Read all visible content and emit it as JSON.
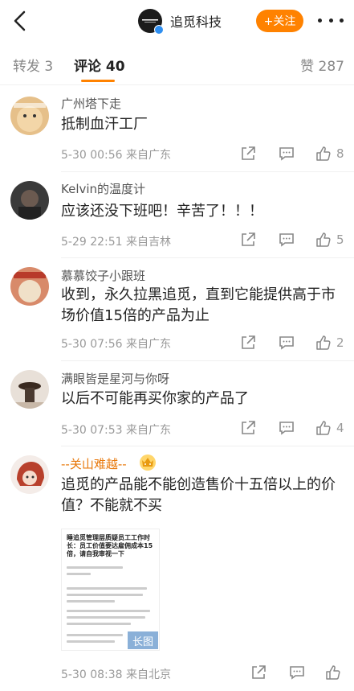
{
  "header": {
    "account_name": "追觅科技",
    "follow_label": "+关注",
    "accent": "#ff8200"
  },
  "tabs": {
    "repost": "转发 3",
    "comments": "评论 40",
    "likes": "赞 287"
  },
  "comments": [
    {
      "user": "广州塔下走",
      "text": "抵制血汗工厂",
      "meta": "5-30 00:56  来自广东",
      "likes": "8"
    },
    {
      "user": "Kelvin的温度计",
      "text": "应该还没下班吧！辛苦了！！！",
      "meta": "5-29 22:51  来自吉林",
      "likes": "5"
    },
    {
      "user": "慕慕饺子小跟班",
      "text": "收到，永久拉黑追觅，直到它能提供高于市场价值15倍的产品为止",
      "meta": "5-30 07:56  来自广东",
      "likes": "2"
    },
    {
      "user": "满眼皆是星河与你呀",
      "text": "以后不可能再买你家的产品了",
      "meta": "5-30 07:53  来自广东",
      "likes": "4"
    },
    {
      "user": "--关山难越--",
      "text": "追觅的产品能不能创造售价十五倍以上的价值？不能就不买",
      "meta": "5-30 08:38  来自北京",
      "likes": ""
    }
  ],
  "long_image": {
    "title": "睡追觅管理层质疑员工工作时长：员工价值要达雇佣成本15倍，请自我审视一下",
    "badge": "长图"
  },
  "icons": [
    "back-icon",
    "more-icon",
    "share-icon",
    "comment-icon",
    "like-icon"
  ]
}
